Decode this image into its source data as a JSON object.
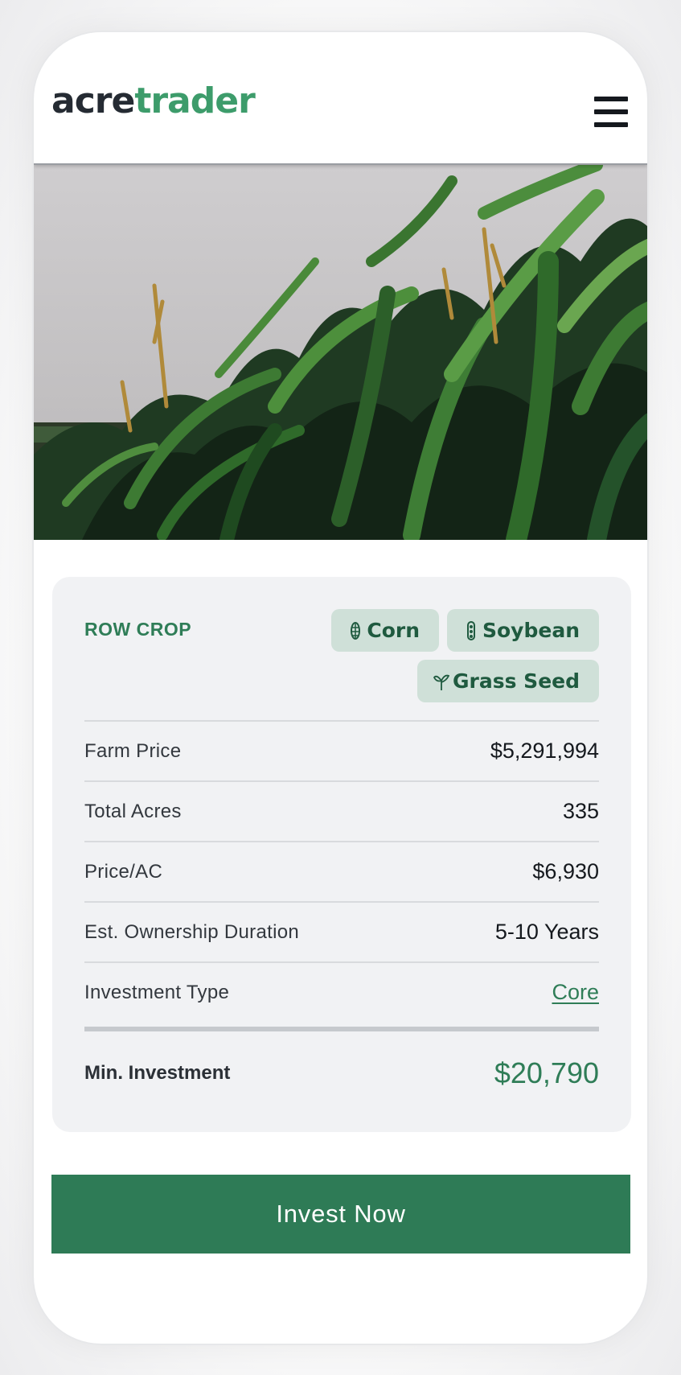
{
  "brand": {
    "logo_part1": "acre",
    "logo_part2": "trader"
  },
  "header": {
    "menu_icon": "hamburger-icon"
  },
  "hero": {
    "image": "cornfield-photo"
  },
  "card": {
    "category": "ROW CROP",
    "tags": [
      {
        "label": "Corn",
        "icon": "corn-icon"
      },
      {
        "label": "Soybean",
        "icon": "soybean-icon"
      },
      {
        "label": "Grass Seed",
        "icon": "sprout-icon"
      }
    ],
    "rows": [
      {
        "label": "Farm Price",
        "value": "$5,291,994"
      },
      {
        "label": "Total Acres",
        "value": "335"
      },
      {
        "label": "Price/AC",
        "value": "$6,930"
      },
      {
        "label": "Est. Ownership Duration",
        "value": "5-10 Years"
      },
      {
        "label": "Investment Type",
        "value": "Core"
      }
    ],
    "min_investment": {
      "label": "Min. Investment",
      "value": "$20,790"
    }
  },
  "cta": {
    "label": "Invest Now"
  },
  "colors": {
    "brand_green": "#2e7b56",
    "logo_green": "#3d9c6b",
    "tag_bg": "#cfe0d8"
  }
}
